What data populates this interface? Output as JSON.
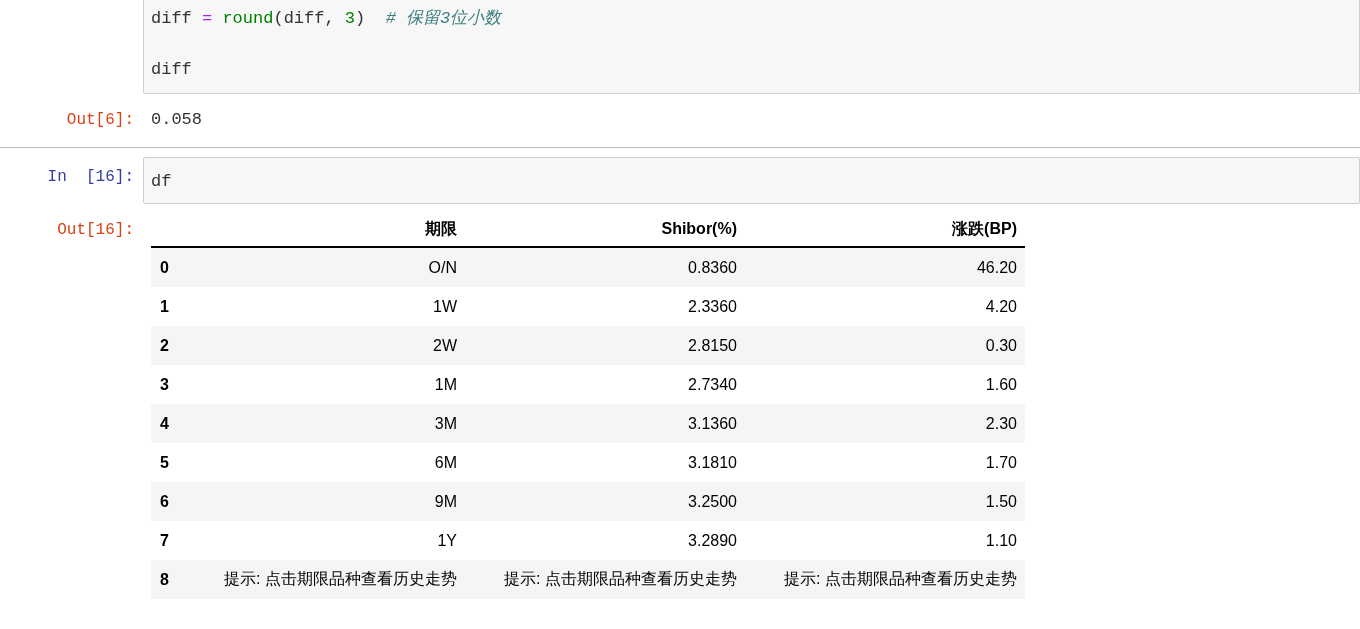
{
  "cells": [
    {
      "kind": "code_with_output",
      "code": [
        {
          "kind": "code",
          "tokens": [
            {
              "kind": "name",
              "text": "diff "
            },
            {
              "kind": "op",
              "text": "= "
            },
            {
              "kind": "builtin",
              "text": "round"
            },
            {
              "kind": "plain",
              "text": "(diff, "
            },
            {
              "kind": "number",
              "text": "3"
            },
            {
              "kind": "plain",
              "text": ")  "
            },
            {
              "kind": "comment",
              "text": "# 保留3位小数"
            }
          ]
        },
        {
          "kind": "blank"
        },
        {
          "kind": "code",
          "tokens": [
            {
              "kind": "name",
              "text": "diff"
            }
          ]
        }
      ],
      "out_prompt": "Out[6]:",
      "output": "0.058"
    },
    {
      "kind": "code_with_table",
      "prompt": "In  [16]:",
      "code": [
        {
          "kind": "code",
          "tokens": [
            {
              "kind": "name",
              "text": "df"
            }
          ]
        }
      ],
      "out_prompt": "Out[16]:",
      "table": {
        "columns": [
          null,
          "期限",
          "Shibor(%)",
          "涨跌(BP)"
        ],
        "rows": [
          [
            "0",
            "O/N",
            "0.8360",
            "46.20"
          ],
          [
            "1",
            "1W",
            "2.3360",
            "4.20"
          ],
          [
            "2",
            "2W",
            "2.8150",
            "0.30"
          ],
          [
            "3",
            "1M",
            "2.7340",
            "1.60"
          ],
          [
            "4",
            "3M",
            "3.1360",
            "2.30"
          ],
          [
            "5",
            "6M",
            "3.1810",
            "1.70"
          ],
          [
            "6",
            "9M",
            "3.2500",
            "1.50"
          ],
          [
            "7",
            "1Y",
            "3.2890",
            "1.10"
          ],
          [
            "8",
            "提示: 点击期限品种查看历史走势",
            "提示: 点击期限品种查看历史走势",
            "提示: 点击期限品种查看历史走势"
          ]
        ]
      }
    }
  ]
}
